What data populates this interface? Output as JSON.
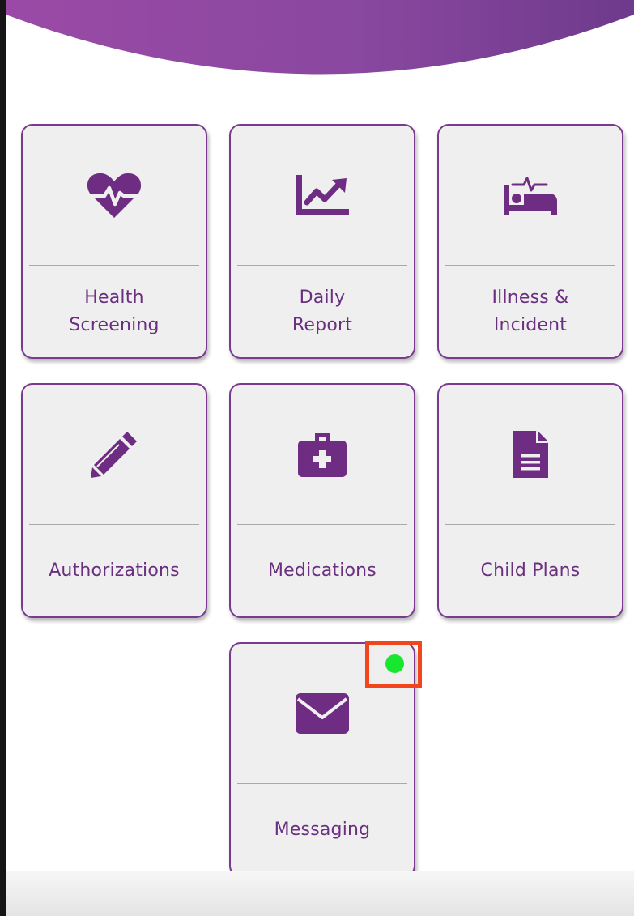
{
  "colors": {
    "brand_purple": "#7b3a8f",
    "icon_purple": "#6e2c82",
    "tile_background": "#efefef",
    "notification_dot": "#17e82f",
    "highlight_box": "#f2451c"
  },
  "menu": {
    "tiles": [
      {
        "label": "Health\nScreening",
        "icon": "heart-pulse-icon"
      },
      {
        "label": "Daily\nReport",
        "icon": "chart-line-icon"
      },
      {
        "label": "Illness &\nIncident",
        "icon": "bed-pulse-icon"
      },
      {
        "label": "Authorizations",
        "icon": "pencil-icon"
      },
      {
        "label": "Medications",
        "icon": "medkit-icon"
      },
      {
        "label": "Child Plans",
        "icon": "document-icon"
      },
      {
        "label": "Messaging",
        "icon": "envelope-icon",
        "has_notification": true
      }
    ]
  }
}
